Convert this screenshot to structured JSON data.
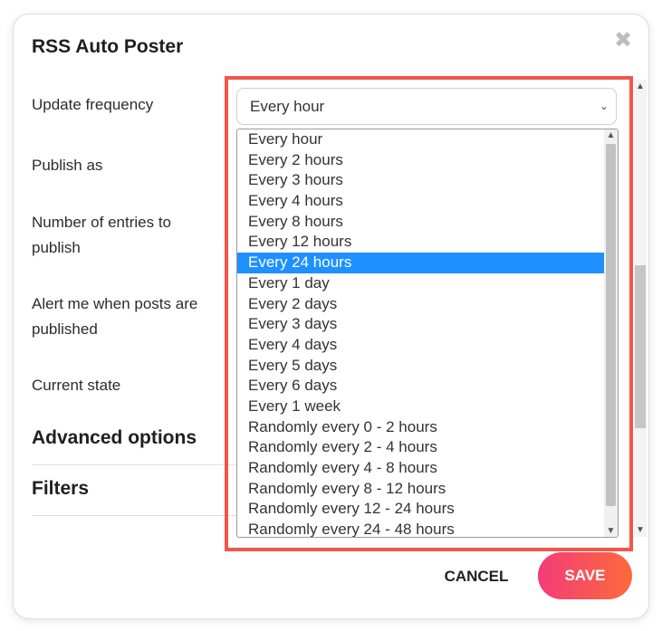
{
  "dialog": {
    "title": "RSS Auto Poster",
    "close_icon": "close-icon"
  },
  "form": {
    "labels": {
      "update_frequency": "Update frequency",
      "publish_as": "Publish as",
      "number_of_entries": "Number of entries to publish",
      "alert_me": "Alert me when posts are published",
      "current_state": "Current state"
    },
    "sections": {
      "advanced_options": "Advanced options",
      "filters": "Filters"
    },
    "update_frequency_select": {
      "value": "Every hour",
      "options": [
        "Every hour",
        "Every 2 hours",
        "Every 3 hours",
        "Every 4 hours",
        "Every 8 hours",
        "Every 12 hours",
        "Every 24 hours",
        "Every 1 day",
        "Every 2 days",
        "Every 3 days",
        "Every 4 days",
        "Every 5 days",
        "Every 6 days",
        "Every 1 week",
        "Randomly every 0 - 2 hours",
        "Randomly every 2 - 4 hours",
        "Randomly every 4 - 8 hours",
        "Randomly every 8 - 12 hours",
        "Randomly every 12 - 24 hours",
        "Randomly every 24 - 48 hours"
      ],
      "highlighted": "Every 24 hours"
    }
  },
  "footer": {
    "cancel_label": "CANCEL",
    "save_label": "SAVE"
  },
  "colors": {
    "highlight_border": "#f2564b",
    "selected_option": "#1e90ff",
    "save_gradient_start": "#f43b78",
    "save_gradient_end": "#fb6b3b"
  }
}
